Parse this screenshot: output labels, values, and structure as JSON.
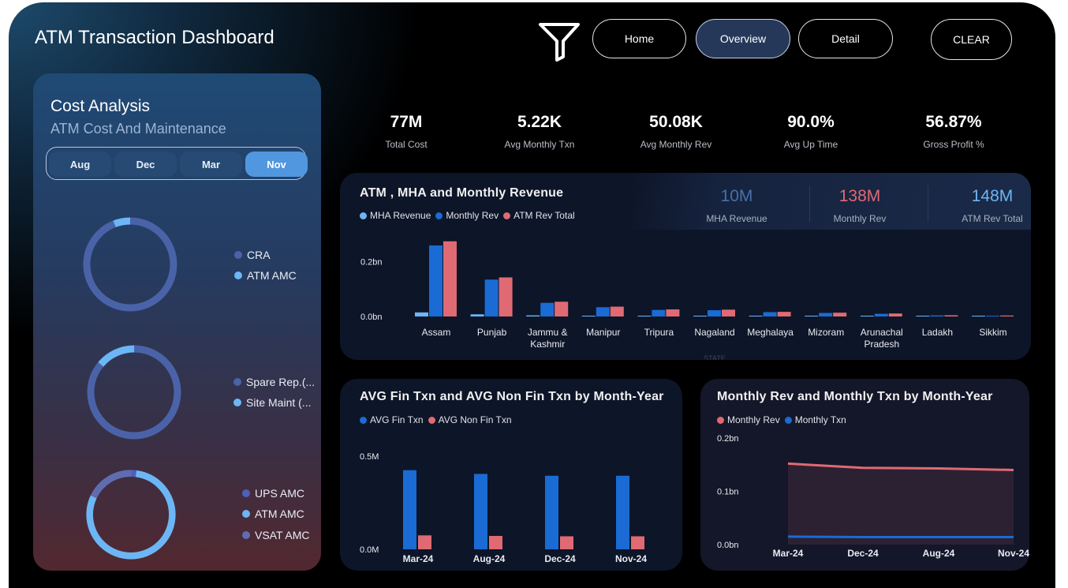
{
  "header": {
    "title": "ATM Transaction Dashboard",
    "nav": {
      "home": "Home",
      "overview": "Overview",
      "detail": "Detail",
      "clear": "CLEAR"
    }
  },
  "cost_panel": {
    "title": "Cost Analysis",
    "subtitle": "ATM Cost And Maintenance",
    "months": [
      "Aug",
      "Dec",
      "Mar",
      "Nov"
    ],
    "selected_month": "Nov",
    "donuts": [
      {
        "legend": [
          "CRA",
          "ATM AMC"
        ],
        "colors": [
          "#4a63a8",
          "#6cb6f5"
        ],
        "shares": [
          0.94,
          0.06
        ]
      },
      {
        "legend": [
          "Spare Rep.(...",
          "Site Maint (..."
        ],
        "colors": [
          "#4a63a8",
          "#6cb6f5"
        ],
        "shares": [
          0.86,
          0.14
        ]
      },
      {
        "legend": [
          "UPS AMC",
          "ATM AMC",
          "VSAT AMC"
        ],
        "colors": [
          "#5060b8",
          "#6cb6f5",
          "#5f6db0"
        ],
        "shares": [
          0.02,
          0.8,
          0.18
        ]
      }
    ]
  },
  "kpis": [
    {
      "value": "77M",
      "label": "Total Cost"
    },
    {
      "value": "5.22K",
      "label": "Avg  Monthly Txn"
    },
    {
      "value": "50.08K",
      "label": "Avg Monthly Rev"
    },
    {
      "value": "90.0%",
      "label": "Avg  Up Time"
    },
    {
      "value": "56.87%",
      "label": "Gross Profit %"
    }
  ],
  "revenue_card": {
    "title": "ATM , MHA and Monthly Revenue",
    "legend": [
      "MHA Revenue",
      "Monthly Rev",
      "ATM Rev Total"
    ],
    "colors": [
      "#6cb6f5",
      "#1a6bd4",
      "#e06a73"
    ],
    "summary": [
      {
        "value": "10M",
        "label": "MHA Revenue",
        "color": "#4a6fa8"
      },
      {
        "value": "138M",
        "label": "Monthly Rev",
        "color": "#e06a73"
      },
      {
        "value": "148M",
        "label": "ATM Rev Total",
        "color": "#6cb6f5"
      }
    ],
    "axis_title": "STATE"
  },
  "fin_card": {
    "title": "AVG Fin Txn and AVG Non Fin Txn by Month-Year",
    "legend": [
      "AVG Fin Txn",
      "AVG Non Fin Txn"
    ],
    "colors": [
      "#1a6bd4",
      "#e06a73"
    ]
  },
  "monthly_card": {
    "title": "Monthly Rev and Monthly Txn by Month-Year",
    "legend": [
      "Monthly Rev",
      "Monthly Txn"
    ],
    "colors": [
      "#e06a73",
      "#1a6bd4"
    ]
  },
  "chart_data": [
    {
      "type": "bar",
      "xlabel": "STATE",
      "categories": [
        "Assam",
        "Punjab",
        "Jammu &\nKashmir",
        "Manipur",
        "Tripura",
        "Nagaland",
        "Meghalaya",
        "Mizoram",
        "Arunachal\nPradesh",
        "Ladakh",
        "Sikkim"
      ],
      "series": [
        {
          "name": "MHA Revenue",
          "values": [
            0.015,
            0.008,
            0.004,
            0.002,
            0.002,
            0.002,
            0.001,
            0.001,
            0.001,
            0.0005,
            0.0005
          ]
        },
        {
          "name": "Monthly Rev",
          "values": [
            0.26,
            0.135,
            0.05,
            0.034,
            0.024,
            0.023,
            0.016,
            0.013,
            0.01,
            0.004,
            0.003
          ]
        },
        {
          "name": "ATM Rev Total",
          "values": [
            0.275,
            0.143,
            0.054,
            0.036,
            0.026,
            0.025,
            0.017,
            0.014,
            0.011,
            0.0045,
            0.0035
          ]
        }
      ],
      "yticks": [
        "0.0bn",
        "0.2bn"
      ],
      "ylim": [
        0,
        0.28
      ]
    },
    {
      "type": "bar",
      "categories": [
        "Mar-24",
        "Aug-24",
        "Dec-24",
        "Nov-24"
      ],
      "series": [
        {
          "name": "AVG Fin Txn",
          "values": [
            0.425,
            0.405,
            0.395,
            0.395
          ]
        },
        {
          "name": "AVG Non Fin Txn",
          "values": [
            0.075,
            0.072,
            0.07,
            0.07
          ]
        }
      ],
      "yticks": [
        "0.0M",
        "0.5M"
      ],
      "ylim": [
        0,
        0.5
      ]
    },
    {
      "type": "area",
      "categories": [
        "Mar-24",
        "Dec-24",
        "Aug-24",
        "Nov-24"
      ],
      "series": [
        {
          "name": "Monthly Rev",
          "values": [
            0.152,
            0.144,
            0.143,
            0.14
          ]
        },
        {
          "name": "Monthly Txn",
          "values": [
            0.015,
            0.014,
            0.014,
            0.014
          ]
        }
      ],
      "yticks": [
        "0.0bn",
        "0.1bn",
        "0.2bn"
      ],
      "ylim": [
        0,
        0.2
      ]
    }
  ]
}
